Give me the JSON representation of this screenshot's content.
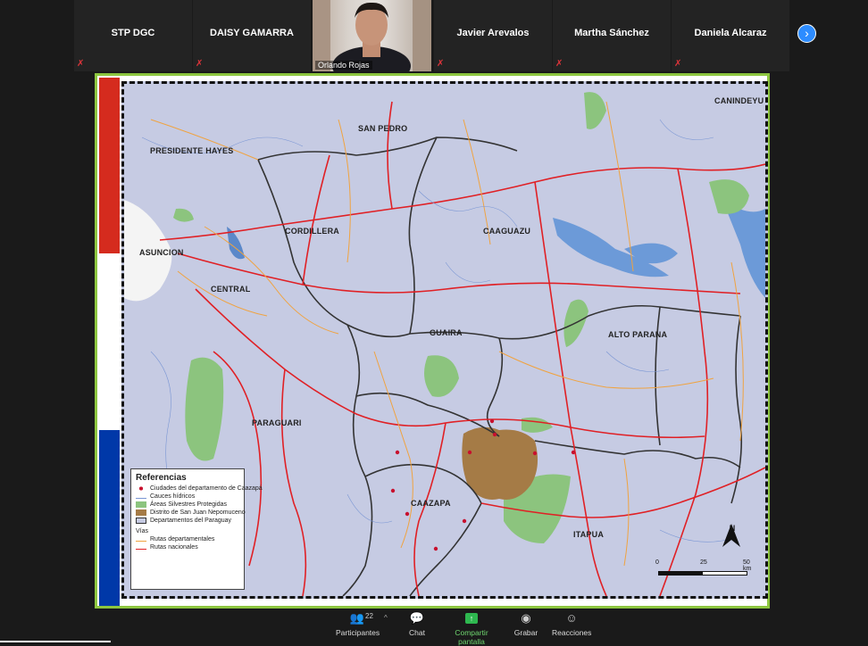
{
  "participants": [
    {
      "name": "STP DGC",
      "muted": true
    },
    {
      "name": "DAISY GAMARRA",
      "muted": true
    },
    {
      "name": "Orlando Rojas",
      "muted": false,
      "video": true
    },
    {
      "name": "Javier Arevalos",
      "muted": true
    },
    {
      "name": "Martha Sánchez",
      "muted": true
    },
    {
      "name": "Daniela Alcaraz",
      "muted": true
    }
  ],
  "next_icon": "chevron-right-icon",
  "map": {
    "labels": {
      "canindeyu": "CANINDEYU",
      "san_pedro": "SAN PEDRO",
      "presidente_hayes": "PRESIDENTE HAYES",
      "cordillera": "CORDILLERA",
      "caaguazu": "CAAGUAZU",
      "asuncion": "ASUNCION",
      "central": "CENTRAL",
      "guaira": "GUAIRA",
      "alto_parana": "ALTO PARANA",
      "paraguari": "PARAGUARI",
      "caazapa": "CAAZAPA",
      "itapua": "ITAPUA"
    },
    "legend": {
      "title": "Referencias",
      "items": [
        "Ciudades del departamento de Caazapá",
        "Cauces hídricos",
        "Áreas Silvestres Protegidas",
        "Distrito de San Juan Nepomuceno",
        "Departamentos del Paraguay"
      ],
      "vias_title": "Vías",
      "vias": [
        "Rutas departamentales",
        "Rutas nacionales"
      ]
    },
    "scale": {
      "zero": "0",
      "mid": "25",
      "end": "50 km"
    },
    "north": "N",
    "colors": {
      "water": "#6c9ad8",
      "protected": "#8cc47e",
      "district": "#a57b46",
      "national_route": "#e02025",
      "department_route": "#f0a340",
      "background": "#c6cbe3"
    }
  },
  "toolbar": {
    "participants_label": "Participantes",
    "participants_count": "22",
    "chat_label": "Chat",
    "share_label": "Compartir pantalla",
    "record_label": "Grabar",
    "reactions_label": "Reacciones"
  }
}
